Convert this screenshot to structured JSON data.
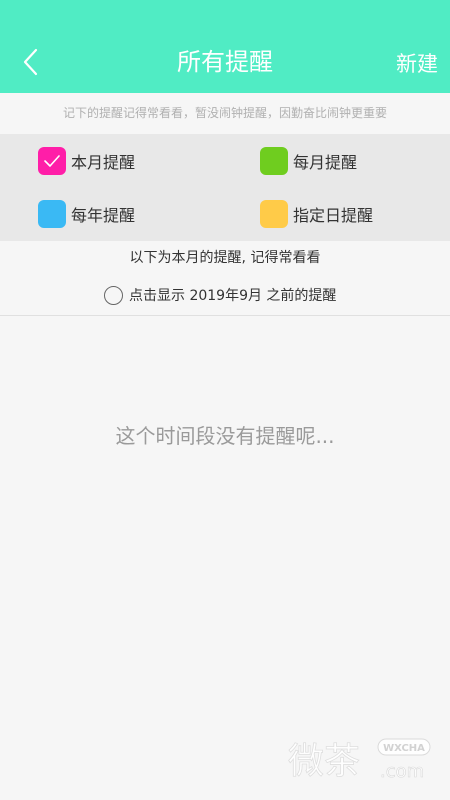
{
  "header": {
    "title": "所有提醒",
    "new_label": "新建",
    "background_color": "#50ecc4"
  },
  "hint": "记下的提醒记得常看看，暂没闹钟提醒，因勤奋比闹钟更重要",
  "filters": [
    {
      "label": "本月提醒",
      "color": "#ff1ea8",
      "checked": true
    },
    {
      "label": "每月提醒",
      "color": "#6fcd1f",
      "checked": false
    },
    {
      "label": "每年提醒",
      "color": "#3ab9f4",
      "checked": false
    },
    {
      "label": "指定日提醒",
      "color": "#ffcb48",
      "checked": false
    }
  ],
  "note": "以下为本月的提醒, 记得常看看",
  "show_previous": {
    "label": "点击显示 2019年9月 之前的提醒",
    "checked": false
  },
  "empty_text": "这个时间段没有提醒呢...",
  "watermark": {
    "logo_text": "微茶",
    "badge": "WXCHA",
    "domain": ".com"
  },
  "icons": {
    "back": "chevron-left-icon",
    "check": "check-icon",
    "radio": "radio-unchecked-icon"
  }
}
